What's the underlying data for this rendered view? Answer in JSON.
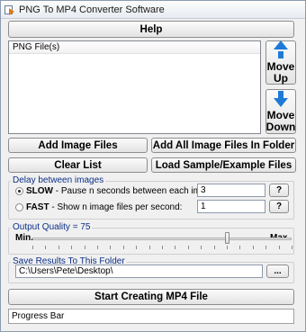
{
  "window": {
    "title": "PNG To MP4 Converter Software"
  },
  "buttons": {
    "help": "Help",
    "move_up_1": "Move",
    "move_up_2": "Up",
    "move_down_1": "Move",
    "move_down_2": "Down",
    "add_image_files": "Add Image Files",
    "add_all_image_files": "Add All Image Files In Folder",
    "clear_list": "Clear List",
    "load_sample": "Load Sample/Example Files",
    "start": "Start Creating MP4 File",
    "help_q": "?",
    "browse": "..."
  },
  "file_list": {
    "header": "PNG File(s)"
  },
  "delay": {
    "label": "Delay between images",
    "slow_bold": "SLOW",
    "slow_rest": " - Pause n seconds between each image file:",
    "slow_value": "3",
    "fast_bold": "FAST",
    "fast_rest": " - Show n image files per second:",
    "fast_value": "1",
    "selected": "slow"
  },
  "quality": {
    "label": "Output Quality = 75",
    "min": "Min.",
    "max": "Max.",
    "value": 75
  },
  "output": {
    "label": "Save Results To This Folder",
    "path": "C:\\Users\\Pete\\Desktop\\"
  },
  "status": {
    "progress_text": "Progress Bar"
  }
}
